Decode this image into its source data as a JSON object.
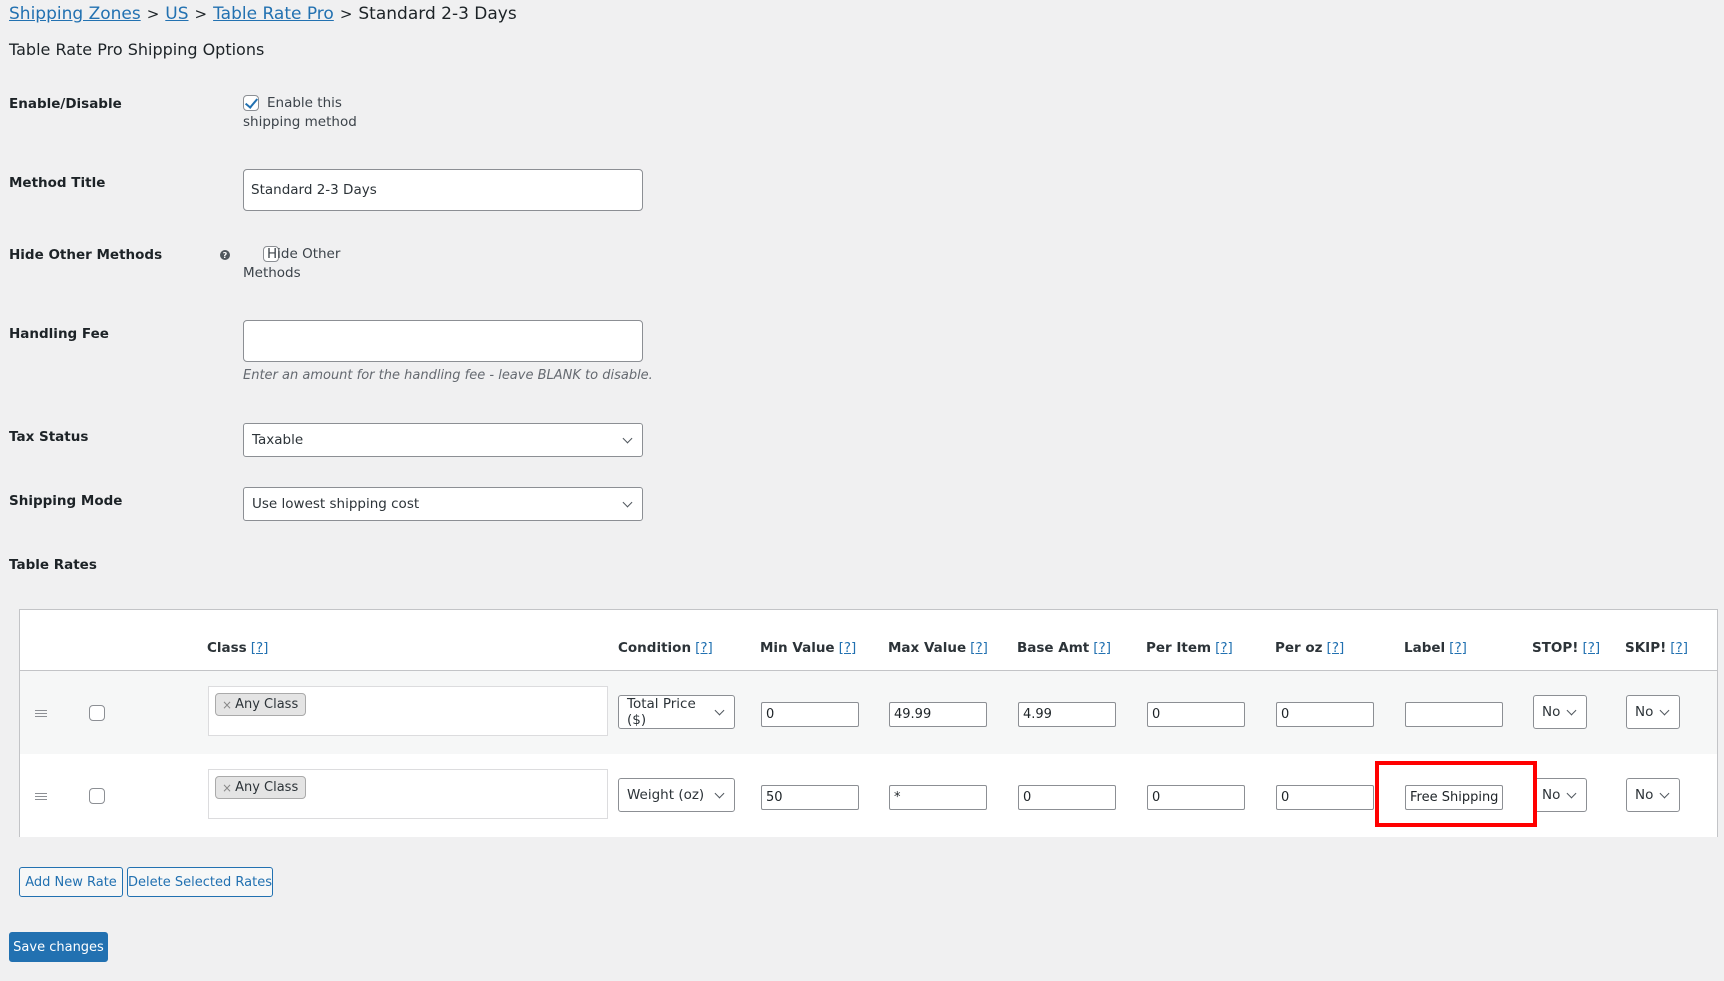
{
  "breadcrumb": {
    "items": [
      {
        "label": "Shipping Zones",
        "link": true
      },
      {
        "label": "US",
        "link": true
      },
      {
        "label": "Table Rate Pro",
        "link": true
      },
      {
        "label": "Standard 2-3 Days",
        "link": false
      }
    ],
    "separator": ">"
  },
  "page_title": "Table Rate Pro Shipping Options",
  "fields": {
    "enable": {
      "label": "Enable/Disable",
      "checkbox_label": "Enable this shipping method",
      "checked": true
    },
    "method_title": {
      "label": "Method Title",
      "value": "Standard 2-3 Days"
    },
    "hide_other": {
      "label": "Hide Other Methods",
      "help_icon": "question-circle-icon",
      "checkbox_label": "Hide Other Methods",
      "checked": false
    },
    "handling_fee": {
      "label": "Handling Fee",
      "value": "",
      "description": "Enter an amount for the handling fee - leave BLANK to disable."
    },
    "tax_status": {
      "label": "Tax Status",
      "value": "Taxable"
    },
    "shipping_mode": {
      "label": "Shipping Mode",
      "value": "Use lowest shipping cost"
    },
    "table_rates": {
      "label": "Table Rates"
    }
  },
  "table": {
    "help_marker": "[?]",
    "columns": [
      "Class",
      "Condition",
      "Min Value",
      "Max Value",
      "Base Amt",
      "Per Item",
      "Per oz",
      "Label",
      "STOP!",
      "SKIP!"
    ],
    "rows": [
      {
        "selected": false,
        "class_tags": [
          "Any Class"
        ],
        "condition": "Total Price ($)",
        "min": "0",
        "max": "49.99",
        "base": "4.99",
        "per_item": "0",
        "per_oz": "0",
        "label": "",
        "stop": "No",
        "skip": "No"
      },
      {
        "selected": false,
        "class_tags": [
          "Any Class"
        ],
        "condition": "Weight (oz)",
        "min": "50",
        "max": "*",
        "base": "0",
        "per_item": "0",
        "per_oz": "0",
        "label": "Free Shipping",
        "stop": "No",
        "skip": "No",
        "highlighted_field": "label"
      }
    ],
    "chip_remove": "×"
  },
  "buttons": {
    "add_rate": "Add New Rate",
    "delete_rates": "Delete Selected Rates",
    "save": "Save changes"
  },
  "colors": {
    "accent": "#2271b1",
    "highlight": "#ff0000",
    "background": "#f0f0f1"
  }
}
